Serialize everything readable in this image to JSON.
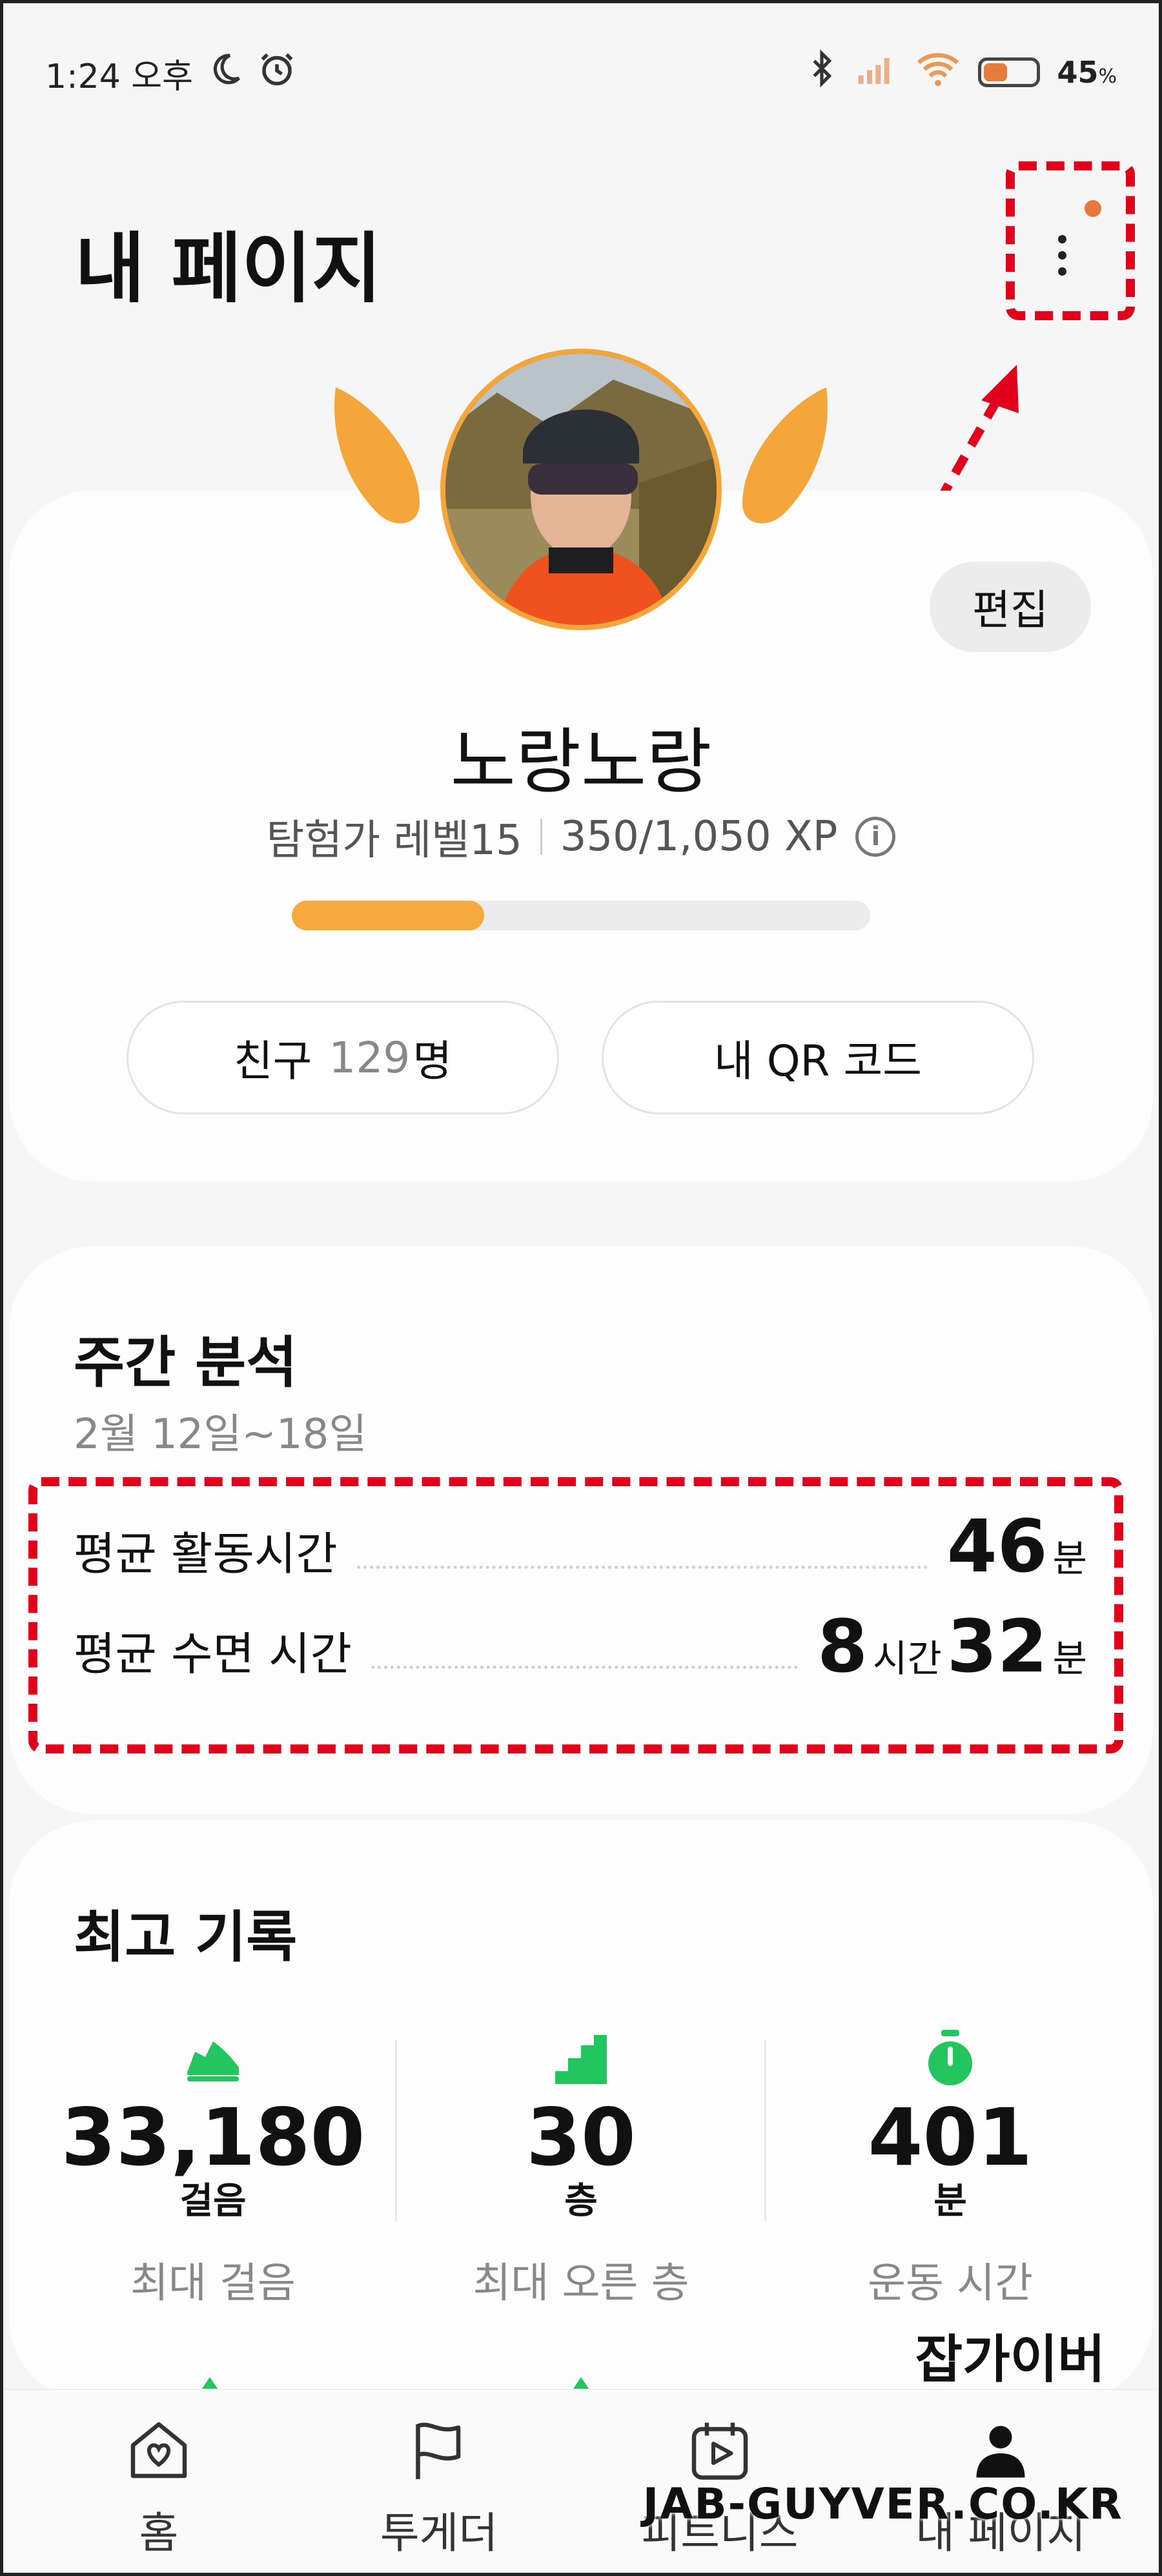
{
  "status_bar": {
    "time": "1:24 오후",
    "battery": "45",
    "battery_unit": "%",
    "battery_level": 0.45,
    "icons": [
      "moon-icon",
      "alarm-icon",
      "bluetooth-icon",
      "signal-icon",
      "wifi-icon",
      "battery-icon"
    ]
  },
  "header": {
    "title": "내 페이지",
    "more_icon": "more-vertical-icon"
  },
  "profile": {
    "edit_label": "편집",
    "nickname": "노랑노랑",
    "level": "탐험가 레벨15",
    "xp": "350/1,050 XP",
    "xp_progress": 0.333,
    "friends_label": "친구",
    "friends_count": "129",
    "friends_unit": "명",
    "qr_label": "내 QR 코드"
  },
  "weekly": {
    "title": "주간 분석",
    "range": "2월 12일~18일",
    "rows": [
      {
        "label": "평균 활동시간",
        "value1": "46",
        "unit1": "분"
      },
      {
        "label": "평균 수면 시간",
        "value1": "8",
        "unit1": "시간",
        "value2": "32",
        "unit2": "분"
      }
    ]
  },
  "records": {
    "title": "최고 기록",
    "items": [
      {
        "icon": "shoe-icon",
        "value": "33,180",
        "unit": "걸음",
        "label": "최대 걸음"
      },
      {
        "icon": "stairs-icon",
        "value": "30",
        "unit": "층",
        "label": "최대 오른 층"
      },
      {
        "icon": "stopwatch-icon",
        "value": "401",
        "unit": "분",
        "label": "운동 시간"
      }
    ]
  },
  "bottom_nav": {
    "items": [
      {
        "label": "홈",
        "icon": "home-icon"
      },
      {
        "label": "투게더",
        "icon": "flag-icon"
      },
      {
        "label": "피트니스",
        "icon": "calendar-play-icon"
      },
      {
        "label": "내 페이지",
        "icon": "person-icon"
      }
    ]
  },
  "watermark": {
    "korean": "잡가이버",
    "english": "JAB-GUYVER.CO.KR"
  },
  "colors": {
    "accent_orange": "#f6a93d",
    "annotation_red": "#e0001b",
    "record_green": "#22c55e",
    "notification_dot": "#e5793d"
  }
}
